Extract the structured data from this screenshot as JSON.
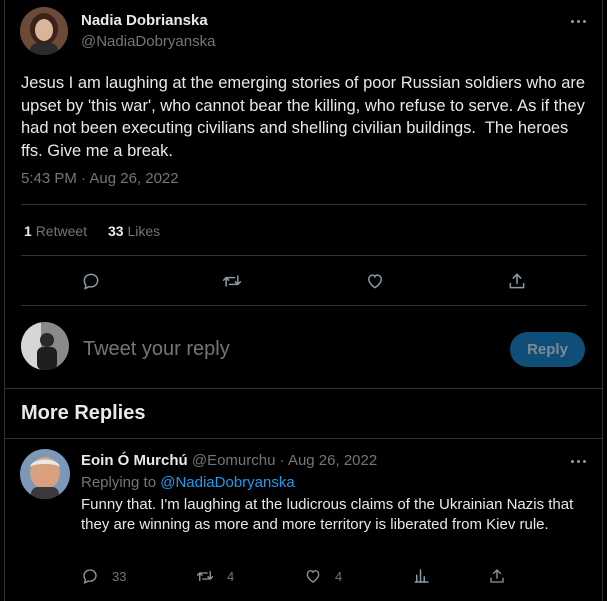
{
  "main_tweet": {
    "author_name": "Nadia Dobrianska",
    "author_handle": "@NadiaDobryanska",
    "text": "Jesus I am laughing at the emerging stories of poor Russian soldiers who are upset by 'this war', who cannot bear the killing, who refuse to serve. As if they had not been executing civilians and shelling civilian buildings.  The heroes ffs. Give me a break.",
    "timestamp": "5:43 PM · Aug 26, 2022",
    "stats": {
      "retweets_count": "1",
      "retweets_label": "Retweet",
      "likes_count": "33",
      "likes_label": "Likes"
    },
    "actions": [
      "reply-icon",
      "retweet-icon",
      "like-icon",
      "share-icon"
    ]
  },
  "compose": {
    "placeholder": "Tweet your reply",
    "reply_button": "Reply"
  },
  "more_replies": {
    "heading": "More Replies"
  },
  "reply_tweet": {
    "author_name": "Eoin Ó Murchú",
    "author_handle": "@Eomurchu",
    "date": "· Aug 26, 2022",
    "replying_to_label": "Replying to",
    "replying_to_handle": "@NadiaDobryanska",
    "text": "Funny that. I'm laughing at the ludicrous claims of the Ukrainian Nazis that they are winning as more and more territory is liberated from Kiev rule.",
    "replies": "33",
    "retweets": "4",
    "likes": "4"
  },
  "colors": {
    "background": "#000000",
    "text": "#e7e9ea",
    "muted": "#71767b",
    "accent": "#1d9bf0",
    "divider": "#2f3336"
  }
}
